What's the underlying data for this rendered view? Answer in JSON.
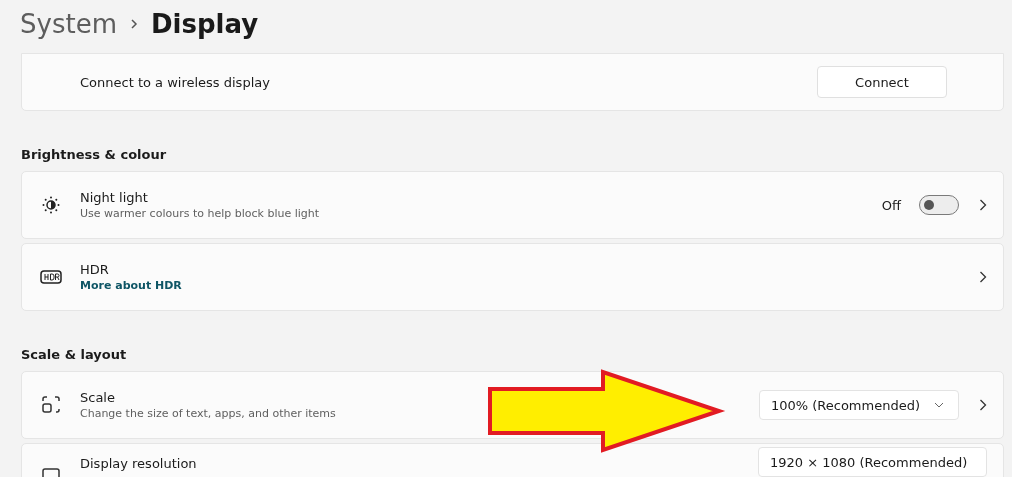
{
  "header": {
    "parent": "System",
    "title": "Display"
  },
  "sections": [
    {
      "rows": [
        {
          "kind": "button",
          "title": "Connect to a wireless display",
          "button": "Connect",
          "chevron": false
        }
      ]
    },
    {
      "heading": "Brightness & colour",
      "rows": [
        {
          "kind": "toggle",
          "title": "Night light",
          "subtitle": "Use warmer colours to help block blue light",
          "state_label": "Off",
          "on": false,
          "chevron": true
        },
        {
          "kind": "link",
          "title": "HDR",
          "link": "More about HDR",
          "chevron": true
        }
      ]
    },
    {
      "heading": "Scale & layout",
      "rows": [
        {
          "kind": "dropdown",
          "title": "Scale",
          "subtitle": "Change the size of text, apps, and other items",
          "value": "100% (Recommended)",
          "chevron": true
        },
        {
          "kind": "dropdown",
          "title": "Display resolution",
          "value": "1920 × 1080 (Recommended)",
          "chevron": false
        }
      ]
    }
  ]
}
